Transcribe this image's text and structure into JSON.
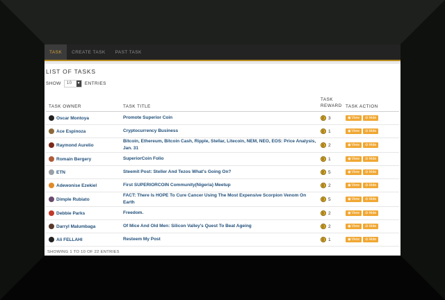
{
  "nav": {
    "tabs": [
      {
        "label": "TASK",
        "active": true
      },
      {
        "label": "CREATE TASK",
        "active": false
      },
      {
        "label": "PAST TASK",
        "active": false
      }
    ]
  },
  "page": {
    "title": "LIST OF TASKS",
    "show_label": "SHOW",
    "show_value": "10",
    "entries_label": "ENTRIES"
  },
  "table": {
    "headers": {
      "owner": "TASK OWNER",
      "title": "TASK TITLE",
      "reward": "TASK REWARD",
      "action": "TASK ACTION"
    },
    "view_label": "View",
    "hide_label": "Hide",
    "rows": [
      {
        "owner": "Oscar Montoya",
        "title": "Promote Superior Coin",
        "reward": "3",
        "avatar_color": "#222222"
      },
      {
        "owner": "Ace Espinoza",
        "title": "Cryptocurrency Business",
        "reward": "1",
        "avatar_color": "#8a6a3a"
      },
      {
        "owner": "Raymond Aurelio",
        "title": "Bitcoin, Ethereum, Bitcoin Cash, Ripple, Stellar, Litecoin, NEM, NEO, EOS: Price Analysis, Jan. 31",
        "reward": "2",
        "avatar_color": "#7a2a1a"
      },
      {
        "owner": "Romain Bergery",
        "title": "SuperiorCoin Folio",
        "reward": "1",
        "avatar_color": "#b05a3a"
      },
      {
        "owner": "ETN",
        "title": "Steemit Post: Steller And Tezos What's Going On?",
        "reward": "5",
        "avatar_color": "#9aa0a6"
      },
      {
        "owner": "Adewonise Ezekiel",
        "title": "First SUPERIORCOIN Community(Nigeria) Meetup",
        "reward": "2",
        "avatar_color": "#e08a2a"
      },
      {
        "owner": "Dimple Rubiato",
        "title": "FACT: There Is HOPE To Cure Cancer Using The Most Expensive Scorpion Venom On Earth",
        "reward": "5",
        "avatar_color": "#6a4a6a"
      },
      {
        "owner": "Debbie Parks",
        "title": "Freedom.",
        "reward": "2",
        "avatar_color": "#c0392b"
      },
      {
        "owner": "Darryl Malumbaga",
        "title": "Of Mice And Old Men: Silicon Valley's Quest To Beat Ageing",
        "reward": "2",
        "avatar_color": "#5a3a2a"
      },
      {
        "owner": "Ali FELLAHI",
        "title": "Resteem My Post",
        "reward": "1",
        "avatar_color": "#222222"
      }
    ]
  },
  "footer": {
    "info": "SHOWING 1 TO 10 OF 22 ENTRIES"
  },
  "colors": {
    "accent": "#f0a732",
    "nav_active_text": "#d1a23c",
    "link": "#1f4e79"
  },
  "icons": {
    "select_arrow": "caret-down-icon",
    "reward": "coin-icon",
    "view": "eye-icon",
    "hide": "eye-slash-icon"
  }
}
